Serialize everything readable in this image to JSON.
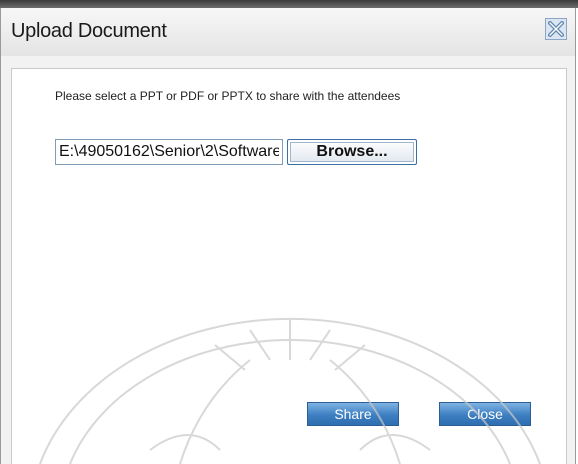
{
  "dialog": {
    "title": "Upload Document",
    "prompt": "Please select a PPT or PDF or PPTX to share with the attendees",
    "file_path_value": "E:\\49050162\\Senior\\2\\Software",
    "browse_label": "Browse...",
    "share_label": "Share",
    "close_label": "Close"
  },
  "icons": {
    "close": "close-x-icon"
  },
  "colors": {
    "action_button": "#3d7fc1",
    "input_border": "#7f9db9"
  }
}
